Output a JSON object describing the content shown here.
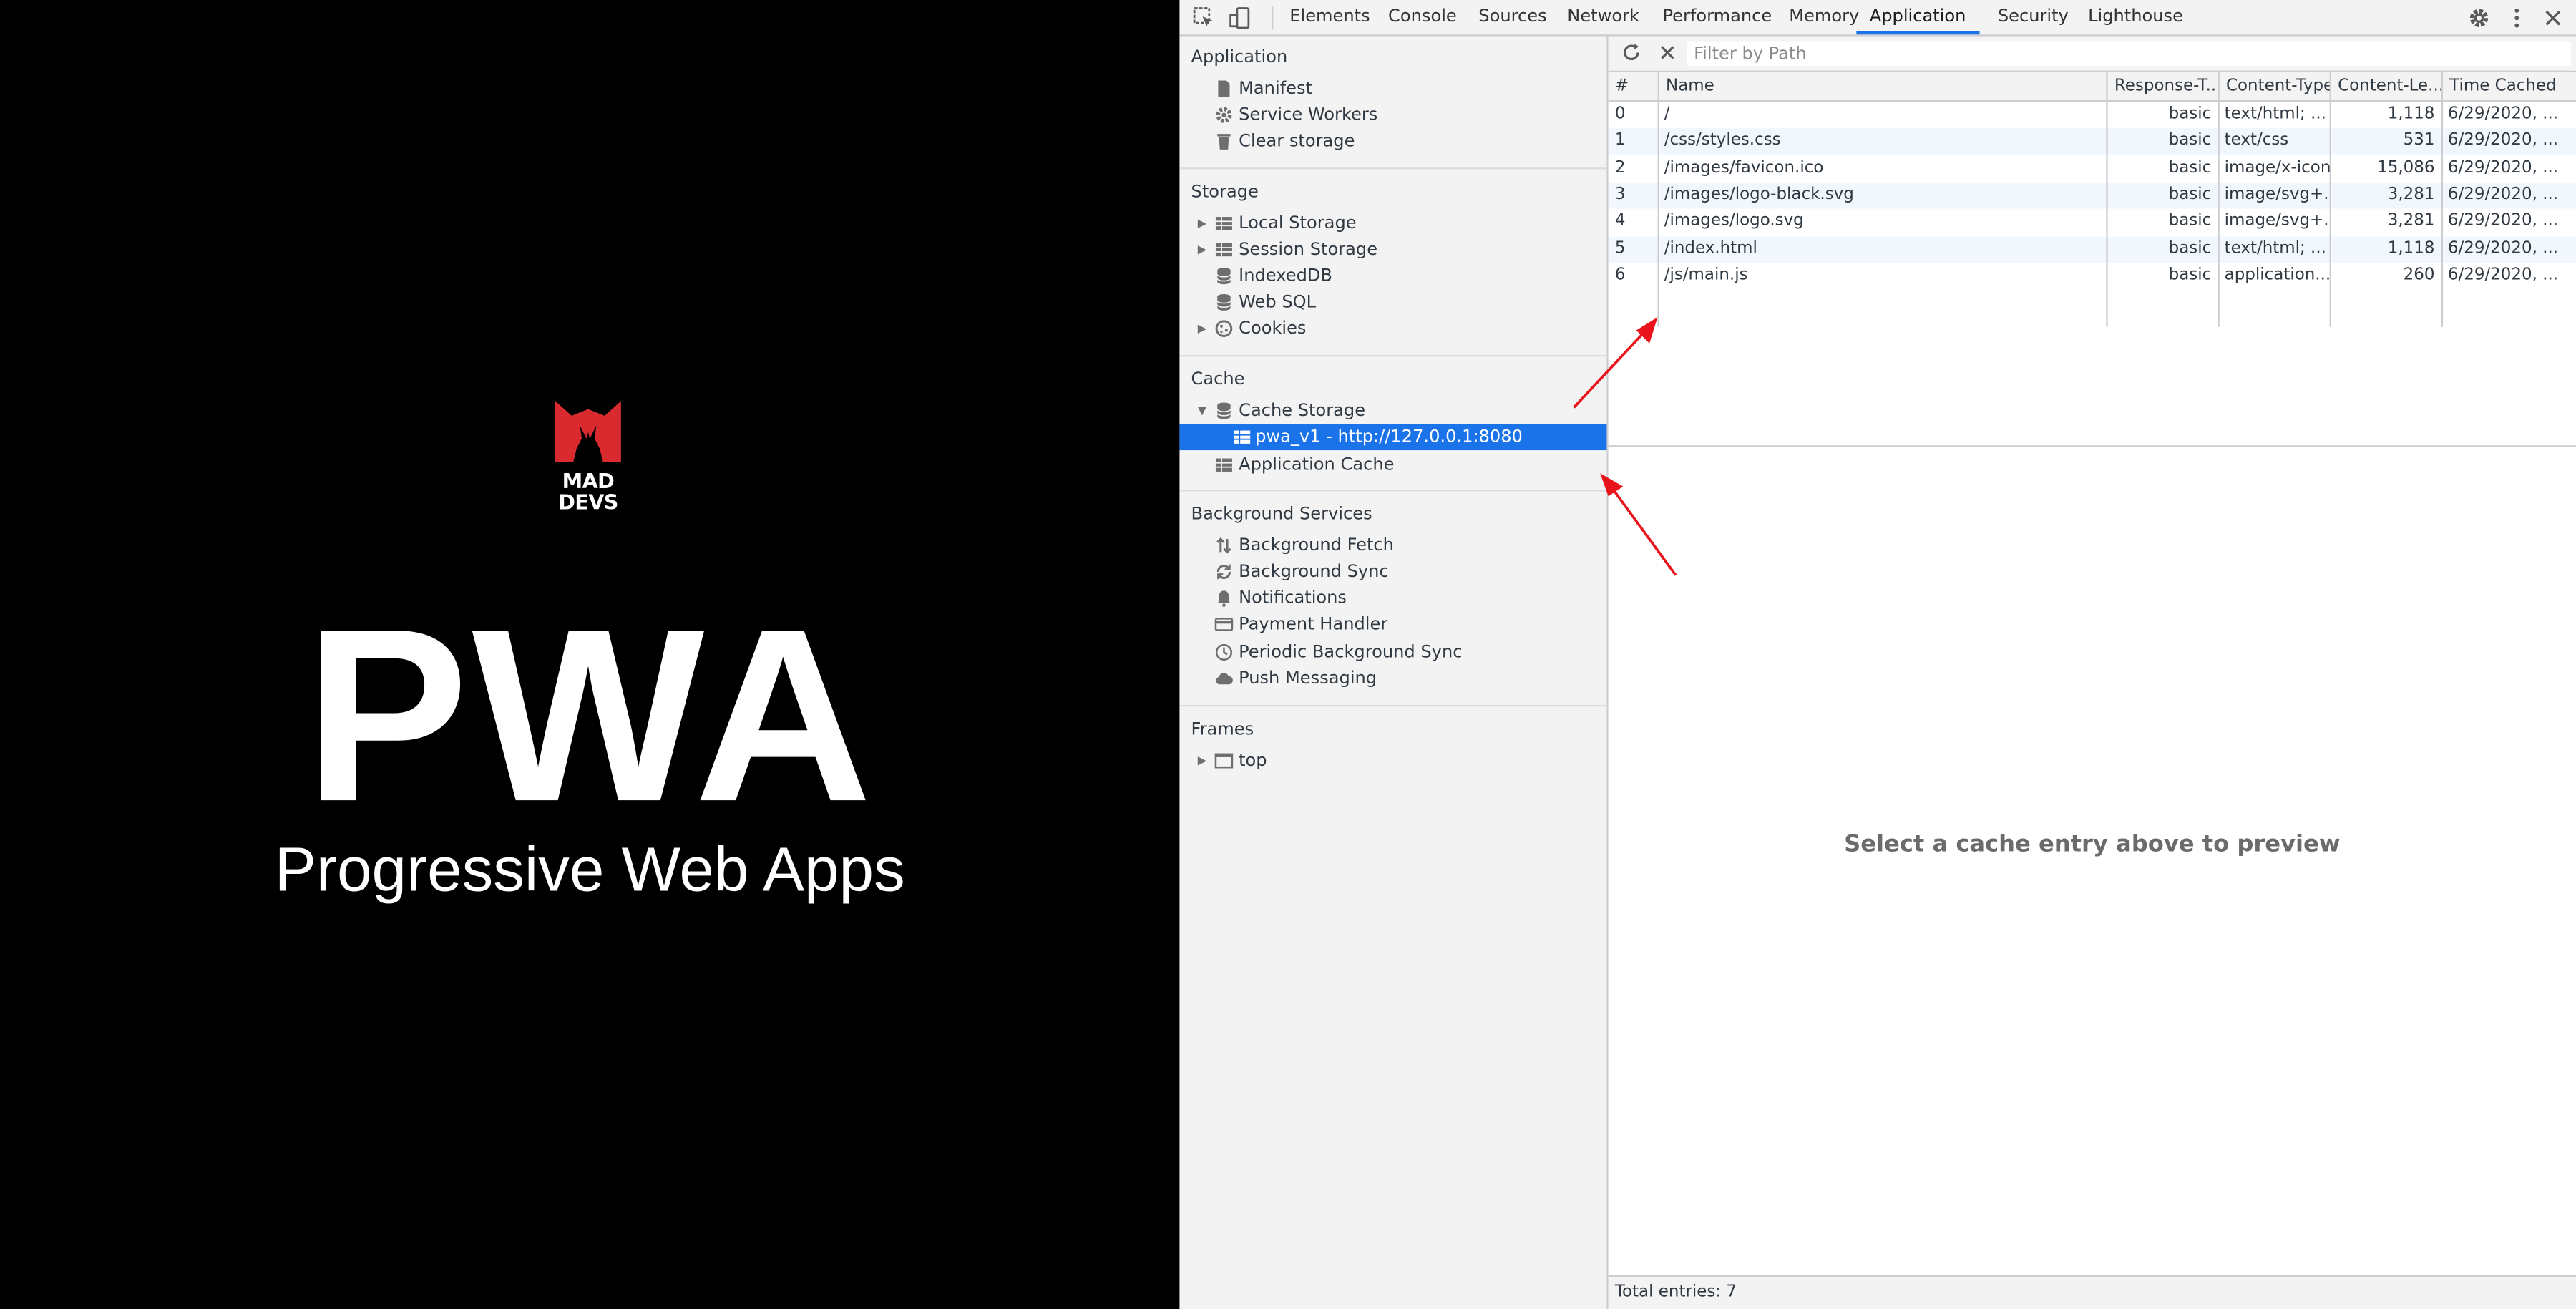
{
  "left": {
    "logo_line1": "MAD",
    "logo_line2": "DEVS",
    "title": "PWA",
    "subtitle": "Progressive Web Apps"
  },
  "toolbar": {
    "tabs": [
      "Elements",
      "Console",
      "Sources",
      "Network",
      "Performance",
      "Memory",
      "Application",
      "Security",
      "Lighthouse"
    ],
    "active_tab": "Application",
    "settings_icon": "gear-icon",
    "more_icon": "kebab-icon",
    "close_icon": "close-icon"
  },
  "sidebar": {
    "application": {
      "title": "Application",
      "items": [
        "Manifest",
        "Service Workers",
        "Clear storage"
      ]
    },
    "storage": {
      "title": "Storage",
      "items": [
        "Local Storage",
        "Session Storage",
        "IndexedDB",
        "Web SQL",
        "Cookies"
      ]
    },
    "cache": {
      "title": "Cache",
      "items": [
        "Cache Storage",
        "pwa_v1 - http://127.0.0.1:8080",
        "Application Cache"
      ]
    },
    "background": {
      "title": "Background Services",
      "items": [
        "Background Fetch",
        "Background Sync",
        "Notifications",
        "Payment Handler",
        "Periodic Background Sync",
        "Push Messaging"
      ]
    },
    "frames": {
      "title": "Frames",
      "items": [
        "top"
      ]
    }
  },
  "filter": {
    "placeholder": "Filter by Path"
  },
  "table": {
    "headers": [
      "#",
      "Name",
      "Response-T...",
      "Content-Type",
      "Content-Le...",
      "Time Cached"
    ],
    "rows": [
      [
        "0",
        "/",
        "basic",
        "text/html; ...",
        "1,118",
        "6/29/2020, ..."
      ],
      [
        "1",
        "/css/styles.css",
        "basic",
        "text/css",
        "531",
        "6/29/2020, ..."
      ],
      [
        "2",
        "/images/favicon.ico",
        "basic",
        "image/x-icon",
        "15,086",
        "6/29/2020, ..."
      ],
      [
        "3",
        "/images/logo-black.svg",
        "basic",
        "image/svg+...",
        "3,281",
        "6/29/2020, ..."
      ],
      [
        "4",
        "/images/logo.svg",
        "basic",
        "image/svg+...",
        "3,281",
        "6/29/2020, ..."
      ],
      [
        "5",
        "/index.html",
        "basic",
        "text/html; ...",
        "1,118",
        "6/29/2020, ..."
      ],
      [
        "6",
        "/js/main.js",
        "basic",
        "application...",
        "260",
        "6/29/2020, ..."
      ]
    ]
  },
  "preview": {
    "empty_message": "Select a cache entry above to preview"
  },
  "status": {
    "total": "Total entries: 7"
  },
  "colors": {
    "accent": "#1a73e8",
    "annotation_arrow": "#e8131b",
    "logo_red": "#d92b2f"
  }
}
